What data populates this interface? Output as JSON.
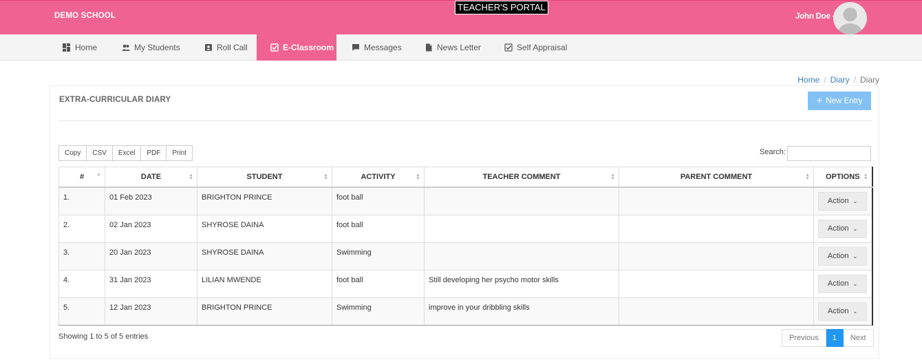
{
  "header": {
    "school": "DEMO SCHOOL",
    "portal": "TEACHER'S PORTAL",
    "user": "John Doe -"
  },
  "nav": [
    {
      "label": "Home",
      "icon": "dashboard-icon"
    },
    {
      "label": "My Students",
      "icon": "users-icon"
    },
    {
      "label": "Roll Call",
      "icon": "contact-card-icon"
    },
    {
      "label": "E-Classroom",
      "icon": "checkbox-icon",
      "active": true
    },
    {
      "label": "Messages",
      "icon": "chat-bubble-icon"
    },
    {
      "label": "News Letter",
      "icon": "document-icon"
    },
    {
      "label": "Self Appraisal",
      "icon": "checkbox-icon"
    }
  ],
  "breadcrumb": [
    "Home",
    "Diary",
    "Diary"
  ],
  "panel": {
    "title": "EXTRA-CURRICULAR DIARY",
    "new_entry": "New Entry"
  },
  "export_buttons": [
    "Copy",
    "CSV",
    "Excel",
    "PDF",
    "Print"
  ],
  "search": {
    "label": "Search:",
    "value": ""
  },
  "table": {
    "columns": [
      "#",
      "DATE",
      "STUDENT",
      "ACTIVITY",
      "TEACHER COMMENT",
      "PARENT COMMENT",
      "OPTIONS"
    ],
    "rows": [
      {
        "num": "1.",
        "date": "01 Feb 2023",
        "student": "BRIGHTON PRINCE",
        "activity": "foot ball",
        "teacher_comment": "",
        "parent_comment": "",
        "action": "Action"
      },
      {
        "num": "2.",
        "date": "02 Jan 2023",
        "student": "SHYROSE DAINA",
        "activity": "foot ball",
        "teacher_comment": "",
        "parent_comment": "",
        "action": "Action"
      },
      {
        "num": "3.",
        "date": "20 Jan 2023",
        "student": "SHYROSE DAINA",
        "activity": "Swimming",
        "teacher_comment": "",
        "parent_comment": "",
        "action": "Action"
      },
      {
        "num": "4.",
        "date": "31 Jan 2023",
        "student": "LILIAN MWENDE",
        "activity": "foot ball",
        "teacher_comment": "Still developing her psycho motor skills",
        "parent_comment": "",
        "action": "Action"
      },
      {
        "num": "5.",
        "date": "12 Jan 2023",
        "student": "BRIGHTON PRINCE",
        "activity": "Swimming",
        "teacher_comment": "improve in your dribbling skills",
        "parent_comment": "",
        "action": "Action"
      }
    ]
  },
  "footer": {
    "info": "Showing 1 to 5 of 5 entries",
    "previous": "Previous",
    "page": "1",
    "next": "Next"
  },
  "colors": {
    "brand": "#f06292",
    "primary": "#2196f3",
    "new_entry": "#83c1f5"
  }
}
